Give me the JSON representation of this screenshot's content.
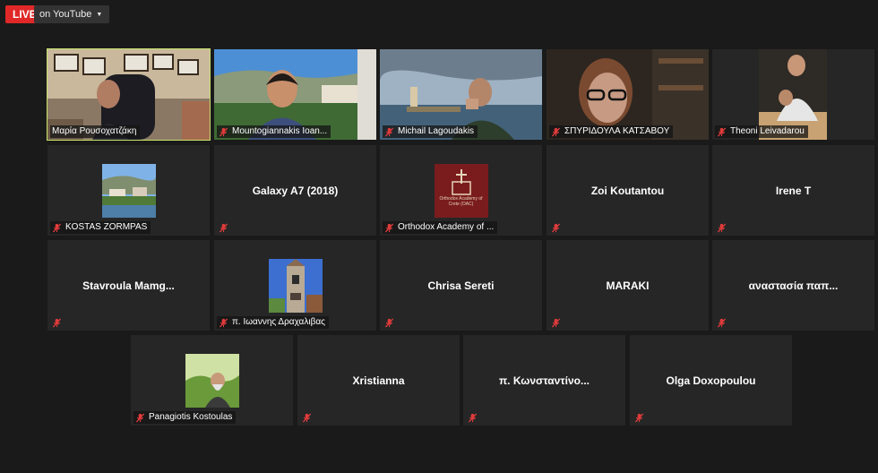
{
  "live": {
    "label": "LIVE",
    "stream_label": "on YouTube"
  },
  "participants": [
    {
      "name": "Μαρία Ρουσοχατζάκη",
      "type": "video",
      "scene": "office",
      "active": true,
      "muted": false
    },
    {
      "name": "Mountogiannakis Ioan...",
      "type": "video",
      "scene": "monastery",
      "muted": true
    },
    {
      "name": "Michail Lagoudakis",
      "type": "video",
      "scene": "lighthouse",
      "muted": true
    },
    {
      "name": "ΣΠΥΡΙΔΟΥΛΑ ΚΑΤΣΑΒΟΥ",
      "type": "video",
      "scene": "glasses",
      "muted": true
    },
    {
      "name": "Theoni Leivadarou",
      "type": "video",
      "scene": "mother",
      "muted": true
    },
    {
      "name": "KOSTAS ZORMPAS",
      "type": "thumb",
      "scene": "lake",
      "muted": true
    },
    {
      "name": "",
      "center": "Galaxy A7 (2018)",
      "type": "text",
      "muted": true
    },
    {
      "name": "Orthodox Academy of ...",
      "type": "thumb",
      "scene": "oac-logo",
      "muted": true,
      "logo_text": "Orthodox Academy of Crete (OAC)"
    },
    {
      "name": "",
      "center": "Zoi Koutantou",
      "type": "text",
      "muted": true
    },
    {
      "name": "",
      "center": "Irene T",
      "type": "text",
      "muted": true
    },
    {
      "name": "",
      "center": "Stavroula  Mamg...",
      "type": "text",
      "muted": true
    },
    {
      "name": "π. Ιωαννης Δραχαλιβας",
      "type": "thumb",
      "scene": "belltower",
      "muted": true
    },
    {
      "name": "",
      "center": "Chrisa Sereti",
      "type": "text",
      "muted": true
    },
    {
      "name": "",
      "center": "MARAKI",
      "type": "text",
      "muted": true
    },
    {
      "name": "",
      "center": "αναστασία παπ...",
      "type": "text",
      "muted": true
    },
    {
      "name": "Panagiotis Kostoulas",
      "type": "thumb",
      "scene": "priest",
      "muted": true
    },
    {
      "name": "",
      "center": "Xristianna",
      "type": "text",
      "muted": true
    },
    {
      "name": "",
      "center": "π.  Κωνσταντίνο...",
      "type": "text",
      "muted": true
    },
    {
      "name": "",
      "center": "Olga Doxopoulou",
      "type": "text",
      "muted": true
    }
  ]
}
